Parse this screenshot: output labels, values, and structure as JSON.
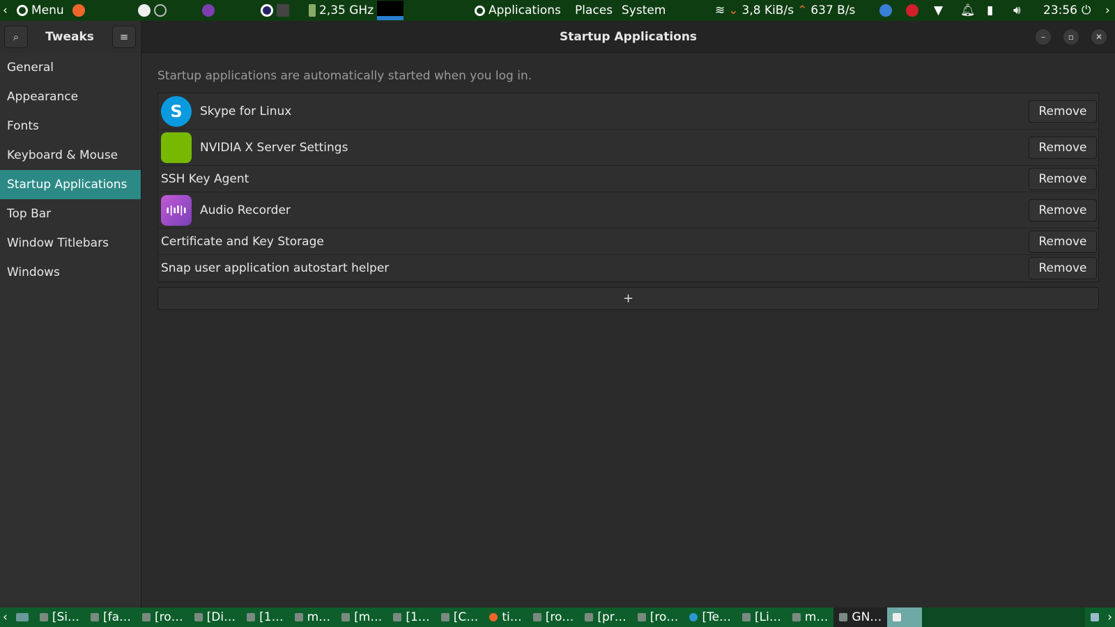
{
  "topbar": {
    "menu": "Menu",
    "cpu": "2,35 GHz",
    "applications": "Applications",
    "places": "Places",
    "system": "System",
    "net_down": "3,8 KiB/s",
    "net_up": "637 B/s",
    "clock": "23:56"
  },
  "window": {
    "app": "Tweaks",
    "title": "Startup Applications"
  },
  "sidebar": {
    "items": [
      {
        "label": "General"
      },
      {
        "label": "Appearance"
      },
      {
        "label": "Fonts"
      },
      {
        "label": "Keyboard & Mouse"
      },
      {
        "label": "Startup Applications"
      },
      {
        "label": "Top Bar"
      },
      {
        "label": "Window Titlebars"
      },
      {
        "label": "Windows"
      }
    ]
  },
  "main": {
    "hint": "Startup applications are automatically started when you log in.",
    "remove_label": "Remove",
    "add_label": "+",
    "apps": [
      {
        "name": "Skype for Linux",
        "icon": "S"
      },
      {
        "name": "NVIDIA X Server Settings"
      },
      {
        "name": "SSH Key Agent"
      },
      {
        "name": "Audio Recorder"
      },
      {
        "name": "Certificate and Key Storage"
      },
      {
        "name": "Snap user application autostart helper"
      }
    ]
  },
  "taskbar": {
    "items": [
      "[Si…",
      "[fa…",
      "[ro…",
      "[Di…",
      "[1…",
      "m…",
      "[m…",
      "[1…",
      "[C…",
      "ti…",
      "[ro…",
      "[pr…",
      "[ro…",
      "[Te…",
      "[Li…",
      "m…",
      "GN…"
    ]
  },
  "colors": {
    "accent": "#2c8a86",
    "panel": "#0f3d12",
    "taskbar": "#0d5e2b"
  }
}
